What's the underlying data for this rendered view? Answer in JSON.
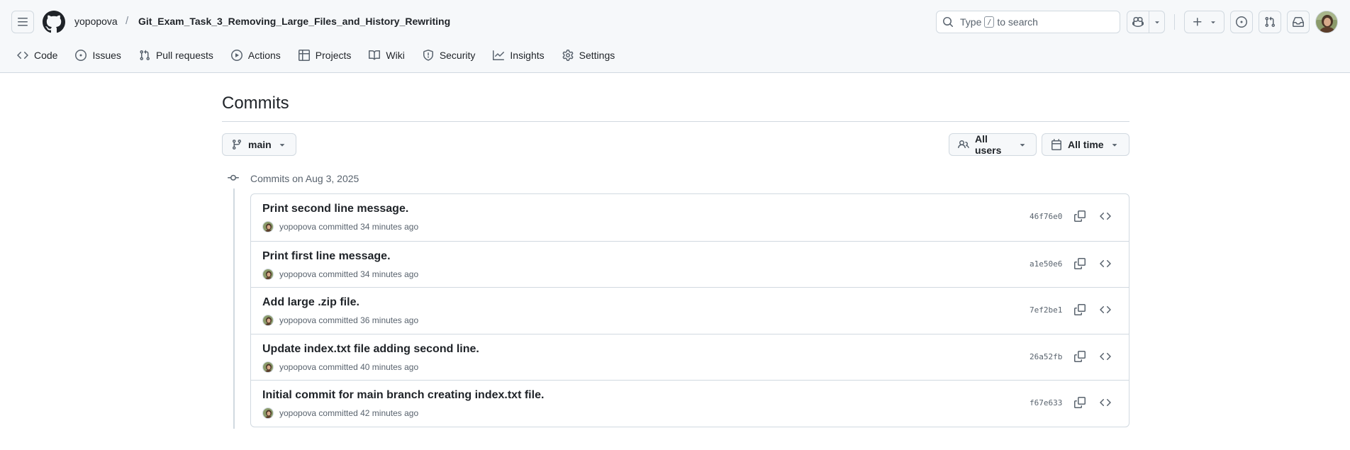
{
  "header": {
    "owner": "yopopova",
    "separator": "/",
    "repo": "Git_Exam_Task_3_Removing_Large_Files_and_History_Rewriting",
    "search_pre": "Type",
    "search_key": "/",
    "search_post": "to search"
  },
  "nav": {
    "items": [
      {
        "label": "Code",
        "icon": "code-icon"
      },
      {
        "label": "Issues",
        "icon": "issue-opened-icon"
      },
      {
        "label": "Pull requests",
        "icon": "git-pull-request-icon"
      },
      {
        "label": "Actions",
        "icon": "play-icon"
      },
      {
        "label": "Projects",
        "icon": "table-icon"
      },
      {
        "label": "Wiki",
        "icon": "book-icon"
      },
      {
        "label": "Security",
        "icon": "shield-icon"
      },
      {
        "label": "Insights",
        "icon": "graph-icon"
      },
      {
        "label": "Settings",
        "icon": "gear-icon"
      }
    ]
  },
  "page": {
    "title": "Commits",
    "branch": "main",
    "users_filter": "All users",
    "time_filter": "All time",
    "group_title": "Commits on Aug 3, 2025"
  },
  "commits": [
    {
      "message": "Print second line message.",
      "author": "yopopova",
      "verb": "committed",
      "time": "34 minutes ago",
      "sha": "46f76e0"
    },
    {
      "message": "Print first line message.",
      "author": "yopopova",
      "verb": "committed",
      "time": "34 minutes ago",
      "sha": "a1e50e6"
    },
    {
      "message": "Add large .zip file.",
      "author": "yopopova",
      "verb": "committed",
      "time": "36 minutes ago",
      "sha": "7ef2be1"
    },
    {
      "message": "Update index.txt file adding second line.",
      "author": "yopopova",
      "verb": "committed",
      "time": "40 minutes ago",
      "sha": "26a52fb"
    },
    {
      "message": "Initial commit for main branch creating index.txt file.",
      "author": "yopopova",
      "verb": "committed",
      "time": "42 minutes ago",
      "sha": "f67e633"
    }
  ],
  "colors": {
    "header_bg": "#f6f8fa",
    "border": "#d1d9e0",
    "text": "#1f2328",
    "muted": "#59636e",
    "active_tab": "#fd8c73"
  }
}
